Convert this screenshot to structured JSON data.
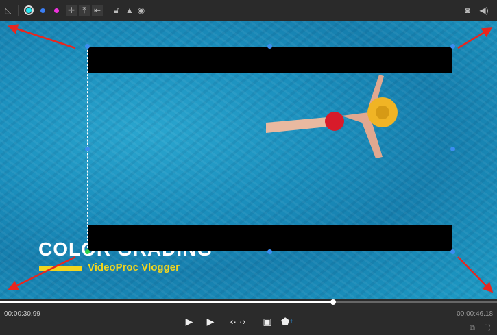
{
  "toolbar": {
    "icons": [
      "ruler-triangle-icon",
      "color-cyan-icon",
      "color-blue-icon",
      "color-magenta-icon",
      "snap-center-icon",
      "snap-top-icon",
      "snap-left-icon",
      "unlock-icon",
      "clean-brush-icon",
      "eye-icon",
      "camera-icon",
      "volume-icon"
    ],
    "colors": {
      "cyan": "#22e5f0",
      "blue": "#3b7ff5",
      "magenta": "#ee33dd"
    }
  },
  "video": {
    "title": "COLOR GRADING",
    "subtitle": "VideoProc Vlogger",
    "accent": "#f2d51e",
    "handle_color": "#3b8df0",
    "arrow_color": "#e8261e"
  },
  "playback": {
    "current_time": "00:00:30.99",
    "total_time": "00:00:46.18",
    "progress": 0.671
  },
  "controls": [
    "play-from-start-icon",
    "play-from-marker-icon",
    "step-frames-icon",
    "crop-frame-icon",
    "add-marker-icon",
    "picture-in-picture-icon",
    "fullscreen-icon"
  ]
}
